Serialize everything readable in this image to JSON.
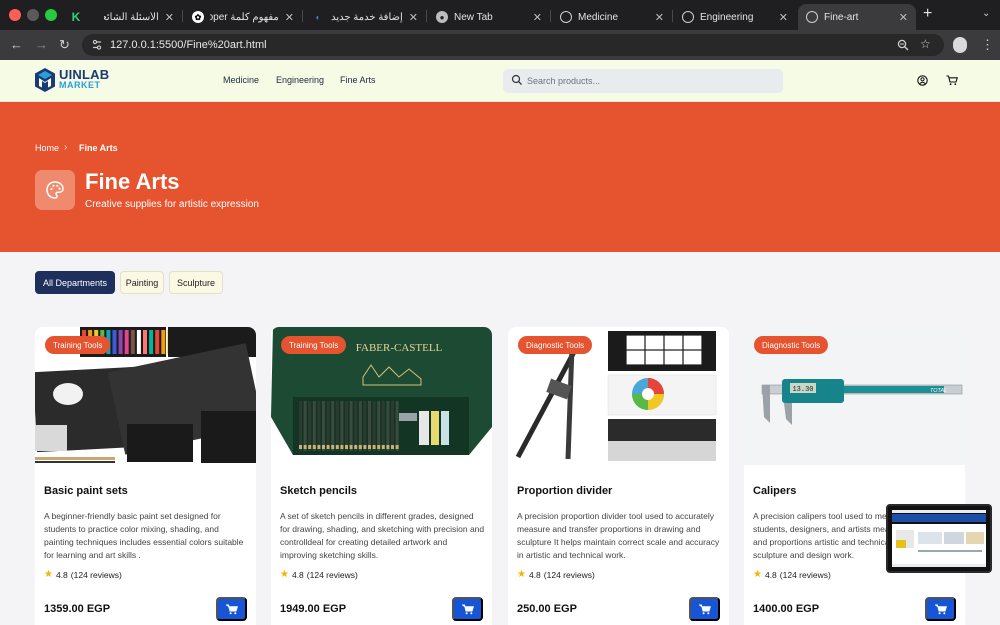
{
  "browser": {
    "tabs": [
      {
        "title": "",
        "icon": "k-app-icon",
        "active": false
      },
      {
        "title": "الأسئلة الشائعة",
        "icon": "globe-icon",
        "active": false
      },
      {
        "title": "مفهوم كلمة Developer",
        "icon": "openai-icon",
        "active": false
      },
      {
        "title": "إضافة خدمة جديد | ...",
        "icon": "app-icon",
        "active": false
      },
      {
        "title": "New Tab",
        "icon": "chrome-icon",
        "active": false
      },
      {
        "title": "Medicine",
        "icon": "globe-icon",
        "active": false
      },
      {
        "title": "Engineering",
        "icon": "globe-icon",
        "active": false
      },
      {
        "title": "Fine-art",
        "icon": "globe-icon",
        "active": true
      }
    ],
    "url": "127.0.0.1:5500/Fine%20art.html"
  },
  "header": {
    "logo_top": "UINLAB",
    "logo_bottom": "MARKET",
    "nav": [
      "Medicine",
      "Engineering",
      "Fine Arts"
    ],
    "search_placeholder": "Search products..."
  },
  "hero": {
    "breadcrumb": [
      "Home",
      "Fine Arts"
    ],
    "title": "Fine Arts",
    "subtitle": "Creative supplies for artistic expression",
    "color": "#e5532f"
  },
  "filters": [
    "All Departments",
    "Painting",
    "Sculpture"
  ],
  "products": [
    {
      "badge": "Training Tools",
      "title": "Basic paint sets",
      "description": "A beginner-friendly basic paint set designed for students to practice color mixing, shading, and painting techniques includes essential colors suitable for learning and art skills .",
      "rating": "4.8",
      "reviews": "(124 reviews)",
      "price": "1359.00 EGP"
    },
    {
      "badge": "Training Tools",
      "title": "Sketch pencils",
      "description": "A set of sketch pencils in different grades, designed for drawing, shading, and sketching with precision and controlldeal for creating detailed artwork and improving sketching skills.",
      "rating": "4.8",
      "reviews": "(124 reviews)",
      "price": "1949.00 EGP"
    },
    {
      "badge": "Diagnostic Tools",
      "title": "Proportion divider",
      "description": "A precision proportion divider tool used to accurately measure and transfer proportions in drawing and sculpture It helps maintain correct scale and accuracy in artistic and technical work.",
      "rating": "4.8",
      "reviews": "(124 reviews)",
      "price": "250.00 EGP"
    },
    {
      "badge": "Diagnostic Tools",
      "title": "Calipers",
      "description": "A precision calipers tool used to measure Sculpture students, designers, and artists measure dimensions and proportions artistic and technical work during sculpture and design work.",
      "rating": "4.8",
      "reviews": "(124 reviews)",
      "price": "1400.00 EGP"
    }
  ],
  "product_images": {
    "box2_brand": "FABER-CASTELL",
    "caliper_brand": "TOTAL",
    "caliper_reading": "13.30"
  },
  "colors": {
    "accent": "#e5532f",
    "button": "#1555d6",
    "filter_active": "#1e2f5c",
    "header_bg": "#f6fbe6"
  }
}
